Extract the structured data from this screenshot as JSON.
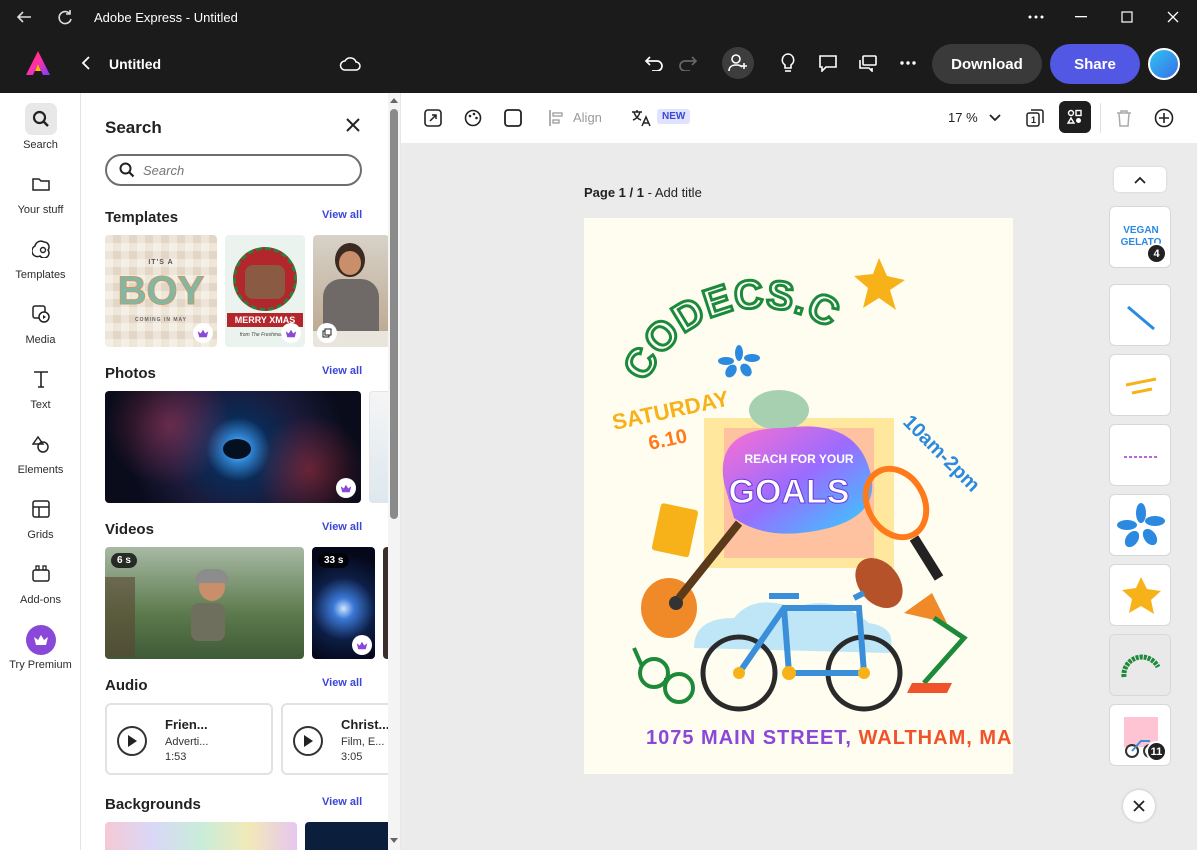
{
  "window": {
    "title": "Adobe Express - Untitled"
  },
  "appbar": {
    "doc_title": "Untitled",
    "download_label": "Download",
    "share_label": "Share"
  },
  "rail": {
    "items": [
      {
        "label": "Search",
        "icon": "search-icon"
      },
      {
        "label": "Your stuff",
        "icon": "folder-icon"
      },
      {
        "label": "Templates",
        "icon": "templates-icon"
      },
      {
        "label": "Media",
        "icon": "media-icon"
      },
      {
        "label": "Text",
        "icon": "text-icon"
      },
      {
        "label": "Elements",
        "icon": "elements-icon"
      },
      {
        "label": "Grids",
        "icon": "grids-icon"
      },
      {
        "label": "Add-ons",
        "icon": "addons-icon"
      },
      {
        "label": "Try Premium",
        "icon": "crown-icon"
      }
    ]
  },
  "panel": {
    "title": "Search",
    "search_placeholder": "Search",
    "view_all": "View all",
    "sections": {
      "templates": "Templates",
      "photos": "Photos",
      "videos": "Videos",
      "audio": "Audio",
      "backgrounds": "Backgrounds"
    },
    "template_thumbs": [
      {
        "line1": "IT'S A",
        "line2": "BOY",
        "line3": "COMING IN MAY"
      },
      {
        "line1": "MERRY XMAS",
        "line2": "from The Freshmakers"
      }
    ],
    "videos": [
      {
        "duration": "6 s"
      },
      {
        "duration": "33 s"
      }
    ],
    "audio": [
      {
        "name": "Frien...",
        "sub": "Adverti...",
        "duration": "1:53"
      },
      {
        "name": "Christ...",
        "sub": "Film, E...",
        "duration": "3:05"
      }
    ]
  },
  "toolbar": {
    "align_label": "Align",
    "new_badge": "NEW",
    "zoom": "17 %"
  },
  "canvas": {
    "page_label_bold": "Page 1 / 1",
    "page_label_rest": " - Add title",
    "poster": {
      "arc_text": "CODECS.COM",
      "date_line1": "SATURDAY",
      "date_line2": "6.10",
      "time": "10am-2pm",
      "headline1": "REACH FOR YOUR",
      "headline2": "GOALS",
      "addr1": "1075 MAIN STREET, ",
      "addr2": "WALTHAM, MA"
    }
  },
  "layers": {
    "badge_first": "4",
    "badge_last": "11",
    "thumb1_line1": "VEGAN",
    "thumb1_line2": "GELATO"
  }
}
